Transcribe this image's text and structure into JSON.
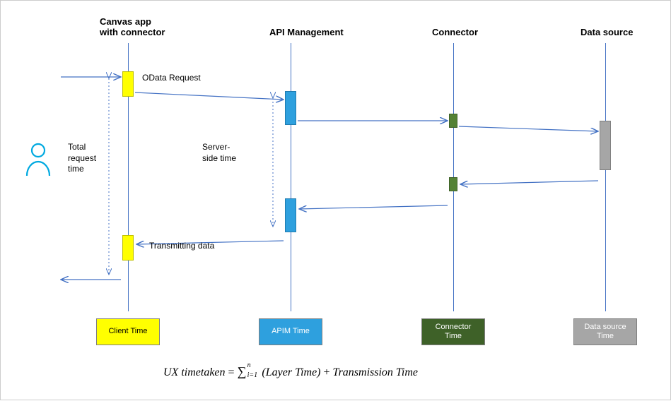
{
  "chart_data": {
    "type": "sequence-diagram",
    "lanes": [
      {
        "id": "client",
        "title": "Canvas app\nwith connector",
        "timebox": "Client Time",
        "color": "yellow"
      },
      {
        "id": "apim",
        "title": "API Management",
        "timebox": "APIM Time",
        "color": "blue"
      },
      {
        "id": "connector",
        "title": "Connector",
        "timebox": "Connector\nTime",
        "color": "green"
      },
      {
        "id": "datasource",
        "title": "Data source",
        "timebox": "Data source\nTime",
        "color": "gray"
      }
    ],
    "labels": {
      "odata_request": "OData Request",
      "transmitting": "Transmitting data",
      "total_request_time": "Total\nrequest\ntime",
      "server_side_time": "Server-\nside time"
    },
    "formula": {
      "lhs": "UX timetaken",
      "rhs_sum_lower": "i=1",
      "rhs_sum_upper": "n",
      "rhs_term1": "(Layer Time)",
      "rhs_term2": "Transmission Time"
    },
    "flow": [
      {
        "from": "user",
        "to": "client",
        "label": "OData Request"
      },
      {
        "from": "client",
        "to": "apim"
      },
      {
        "from": "apim",
        "to": "connector"
      },
      {
        "from": "connector",
        "to": "datasource"
      },
      {
        "from": "datasource",
        "to": "connector"
      },
      {
        "from": "connector",
        "to": "apim"
      },
      {
        "from": "apim",
        "to": "client",
        "label": "Transmitting data"
      },
      {
        "from": "client",
        "to": "user"
      }
    ]
  },
  "headers": {
    "client_l1": "Canvas app",
    "client_l2": "with connector",
    "apim": "API Management",
    "connector": "Connector",
    "datasource": "Data source"
  },
  "labels": {
    "odata": "OData Request",
    "transmit": "Transmitting data",
    "total_l1": "Total",
    "total_l2": "request",
    "total_l3": "time",
    "server_l1": "Server-",
    "server_l2": "side time"
  },
  "boxes": {
    "client": "Client Time",
    "apim": "APIM Time",
    "connector_l1": "Connector",
    "connector_l2": "Time",
    "ds_l1": "Data source",
    "ds_l2": "Time"
  },
  "formula": {
    "lhs": "UX timetaken",
    "eq": " = ",
    "sum": "∑",
    "lower": "i=1",
    "upper": "n",
    "t1": "(Layer Time)",
    "plus": " + ",
    "t2": "Transmission Time"
  }
}
